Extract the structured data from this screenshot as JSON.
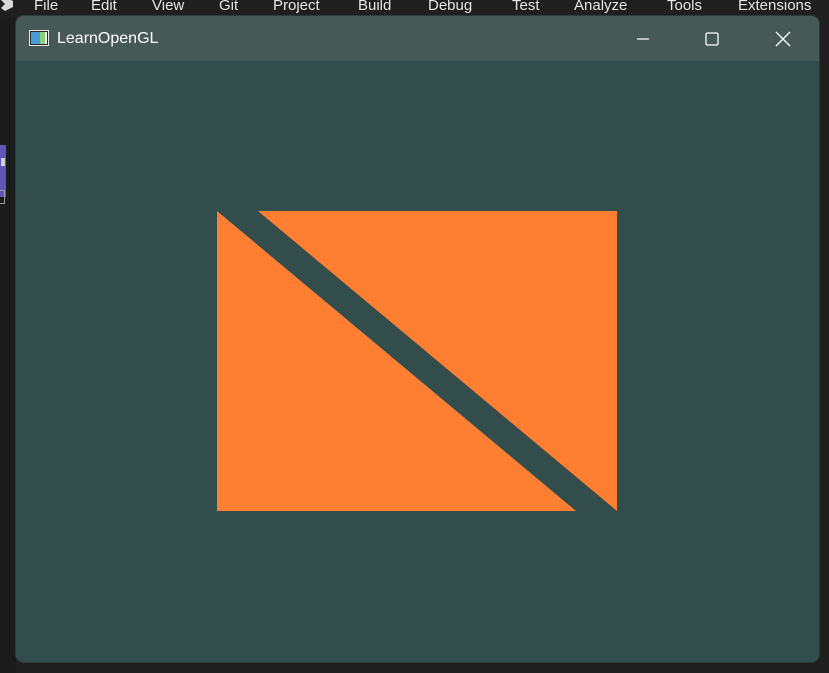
{
  "ide": {
    "menu": [
      {
        "id": "file",
        "label": "File"
      },
      {
        "id": "edit",
        "label": "Edit"
      },
      {
        "id": "view",
        "label": "View"
      },
      {
        "id": "git",
        "label": "Git"
      },
      {
        "id": "project",
        "label": "Project"
      },
      {
        "id": "build",
        "label": "Build"
      },
      {
        "id": "debug",
        "label": "Debug"
      },
      {
        "id": "test",
        "label": "Test"
      },
      {
        "id": "analyze",
        "label": "Analyze"
      },
      {
        "id": "tools",
        "label": "Tools"
      },
      {
        "id": "extensions",
        "label": "Extensions"
      }
    ]
  },
  "window": {
    "title": "LearnOpenGL",
    "icon": "app-window-icon",
    "controls": [
      "minimize-icon",
      "maximize-icon",
      "close-icon"
    ]
  },
  "colors": {
    "clear_color": "#334d4d",
    "triangle_fill": "#ff7f32",
    "titlebar": "#465957",
    "title_text": "#ffffff"
  }
}
